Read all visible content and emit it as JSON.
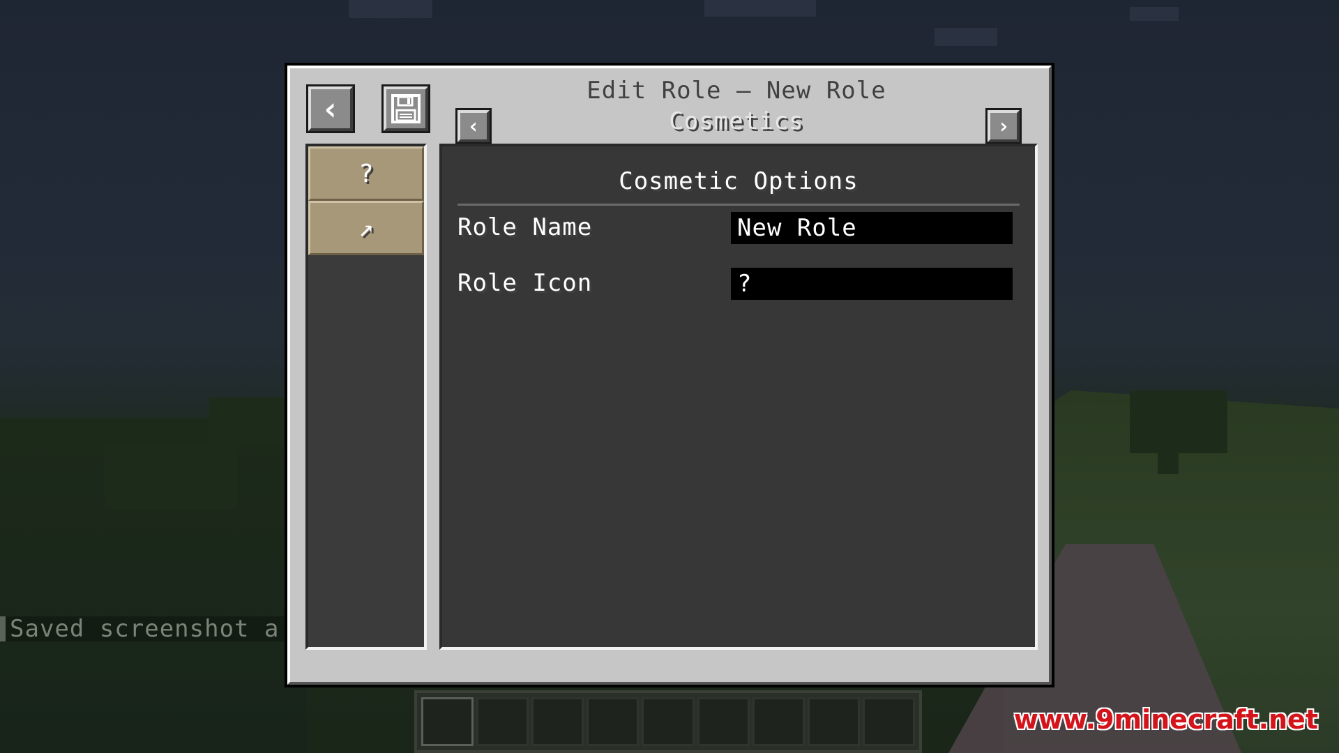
{
  "dialog": {
    "title": "Edit Role — New Role",
    "subtitle": "Cosmetics",
    "back_icon": "‹",
    "prev_icon": "‹",
    "next_icon": "›"
  },
  "sidebar": {
    "items": [
      {
        "icon": "?",
        "name": "question-icon"
      },
      {
        "icon": "↗",
        "name": "pickaxe-icon"
      }
    ]
  },
  "content": {
    "section_title": "Cosmetic Options",
    "fields": [
      {
        "label": "Role Name",
        "value": "New Role"
      },
      {
        "label": "Role Icon",
        "value": "?"
      }
    ]
  },
  "chat": {
    "line": "Saved screenshot a"
  },
  "watermark": "www.9minecraft.net",
  "colors": {
    "panel": "#c6c6c6",
    "content_bg": "#373737",
    "tab_bg": "#a8987a",
    "field_bg": "#000000"
  }
}
